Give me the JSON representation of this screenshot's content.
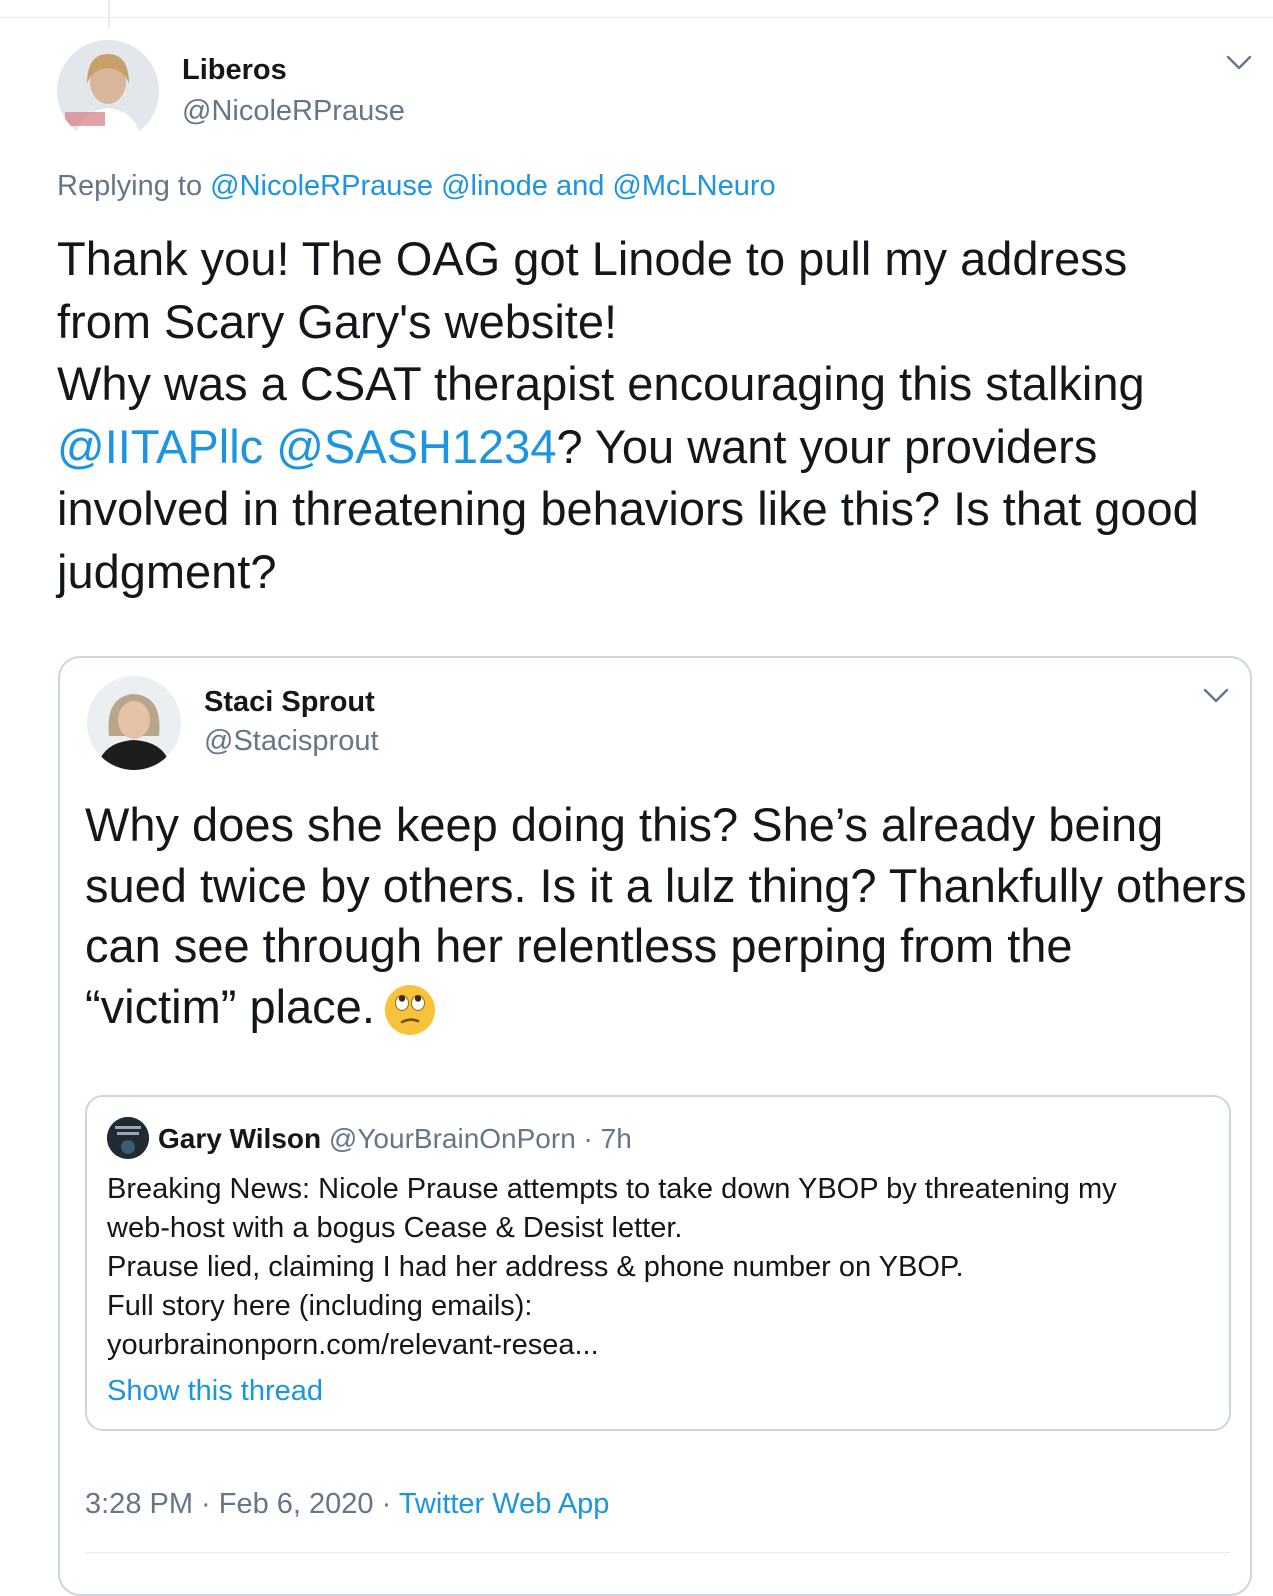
{
  "main_tweet": {
    "author_name": "Liberos",
    "author_handle": "@NicoleRPrause",
    "replying_to_prefix": "Replying to ",
    "replying_to_1": "@NicoleRPrause",
    "replying_to_2": "@linode",
    "replying_to_and": " and ",
    "replying_to_3": "@McLNeuro",
    "text_line_1": "Thank you! The OAG got Linode to pull my address",
    "text_line_2": "from Scary Gary's website!",
    "text_line_3": "Why was a CSAT therapist  encouraging this stalking",
    "mention_1": "@IITAPllc",
    "mention_2": "@SASH1234",
    "text_line_4_rest": "? You want your providers",
    "text_line_5": "involved in threatening behaviors like this? Is that good",
    "text_line_6": "judgment?"
  },
  "quoted_tweet": {
    "author_name": "Staci Sprout",
    "author_handle": "@Stacisprout",
    "text_line_1": "Why does she keep doing this? She’s already being",
    "text_line_2": "sued twice by others. Is it a lulz thing? Thankfully others",
    "text_line_3": "can see through her relentless perping from the",
    "text_line_4": "“victim” place.",
    "emoji_icon": "face-with-rolling-eyes-icon",
    "timestamp": "3:28 PM · Feb 6, 2020 · ",
    "source_app": "Twitter Web App"
  },
  "nested_tweet": {
    "author_name": "Gary Wilson",
    "author_handle": "@YourBrainOnPorn",
    "separator": " · ",
    "time": "7h",
    "text_line_1": "Breaking News: Nicole Prause attempts to take down YBOP by threatening my",
    "text_line_2": "web-host with a bogus Cease & Desist letter.",
    "text_line_3": "Prause lied, claiming I had her address & phone number on YBOP.",
    "text_line_4": "Full story here (including emails):",
    "text_line_5": "yourbrainonporn.com/relevant-resea...",
    "show_thread": "Show this thread"
  },
  "colors": {
    "link": "#1b95e0",
    "muted": "#657786",
    "text": "#14171a",
    "border": "#ccd6dd"
  }
}
